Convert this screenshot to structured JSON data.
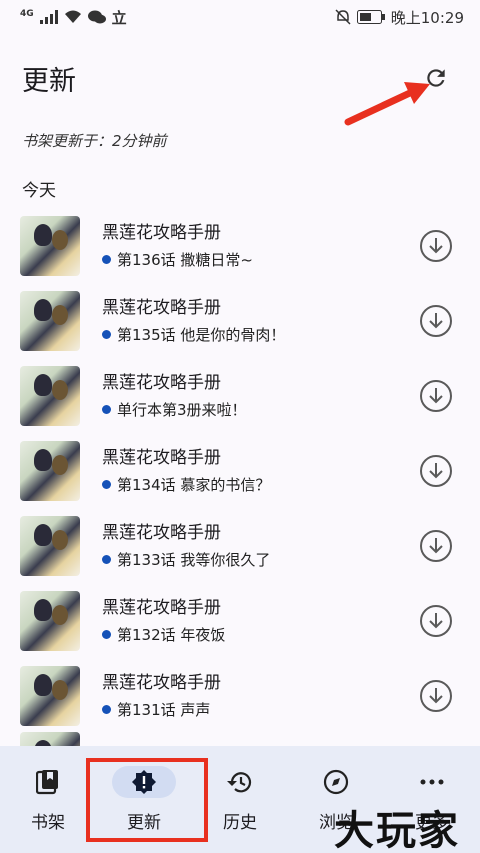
{
  "status_bar": {
    "network": "4G",
    "lock_glyph": "立",
    "time": "晚上10:29"
  },
  "header": {
    "title": "更新"
  },
  "updated_note": "书架更新于：2分钟前",
  "section": "今天",
  "items": [
    {
      "title": "黑莲花攻略手册",
      "chapter": "第136话 撒糖日常~"
    },
    {
      "title": "黑莲花攻略手册",
      "chapter": "第135话 他是你的骨肉！"
    },
    {
      "title": "黑莲花攻略手册",
      "chapter": "单行本第3册来啦！"
    },
    {
      "title": "黑莲花攻略手册",
      "chapter": "第134话 慕家的书信？"
    },
    {
      "title": "黑莲花攻略手册",
      "chapter": "第133话 我等你很久了"
    },
    {
      "title": "黑莲花攻略手册",
      "chapter": "第132话 年夜饭"
    },
    {
      "title": "黑莲花攻略手册",
      "chapter": "第131话 声声"
    }
  ],
  "bottom_nav": [
    {
      "label": "书架",
      "icon": "bookshelf-icon"
    },
    {
      "label": "更新",
      "icon": "update-alert-icon",
      "active": true
    },
    {
      "label": "历史",
      "icon": "history-icon"
    },
    {
      "label": "浏览",
      "icon": "compass-icon"
    },
    {
      "label": "更多",
      "icon": "more-icon"
    }
  ],
  "watermark": "大玩家",
  "colors": {
    "accent": "#1552b8",
    "annotation": "#e8301f",
    "nav_background": "#e8ecf7"
  }
}
